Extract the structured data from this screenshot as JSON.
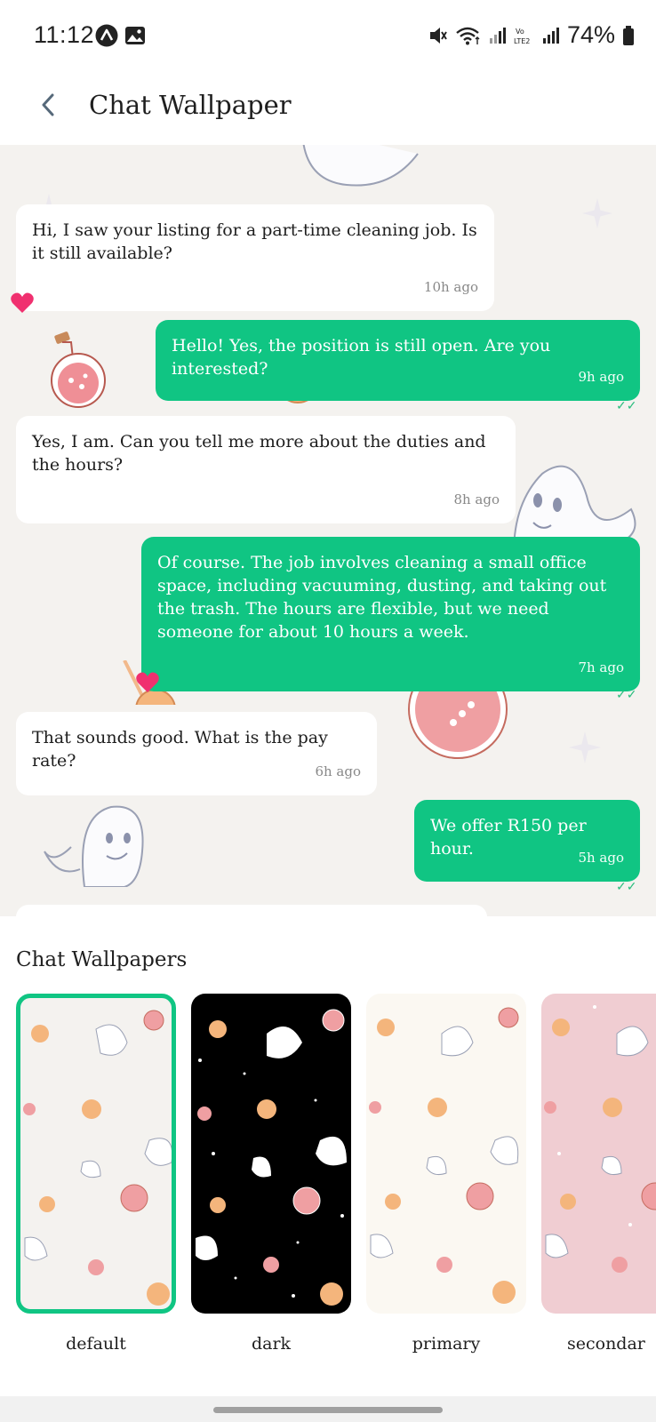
{
  "status_bar": {
    "time": "11:12",
    "battery": "74%",
    "icons": [
      "app-a-icon",
      "gallery-icon",
      "mute-icon",
      "wifi-icon",
      "signal-icon",
      "volte-icon",
      "signal2-icon",
      "battery-icon"
    ]
  },
  "header": {
    "title": "Chat Wallpaper",
    "back_icon": "chevron-left-icon"
  },
  "messages": [
    {
      "direction": "in",
      "text": "Hi, I saw your listing for a part-time cleaning job. Is it still available?",
      "time": "10h ago",
      "liked": true
    },
    {
      "direction": "out",
      "text": "Hello! Yes, the position is still open. Are you interested?",
      "time": "9h ago",
      "read": true
    },
    {
      "direction": "in",
      "text": "Yes, I am. Can you tell me more about the duties and the hours?",
      "time": "8h ago"
    },
    {
      "direction": "out",
      "text": "Of course. The job involves cleaning a small office space, including vacuuming, dusting, and taking out the trash. The hours are flexible, but we need someone for about 10 hours a week.",
      "time": "7h ago",
      "read": true,
      "liked": true
    },
    {
      "direction": "in",
      "text": "That sounds good. What is the pay rate?",
      "time": "6h ago"
    },
    {
      "direction": "out",
      "text": "We offer R150 per hour.",
      "time": "5h ago",
      "read": true
    }
  ],
  "wallpapers": {
    "title": "Chat Wallpapers",
    "items": [
      {
        "label": "default",
        "bg": "#f4f2ef",
        "selected": true
      },
      {
        "label": "dark",
        "bg": "#000000",
        "selected": false
      },
      {
        "label": "primary",
        "bg": "#fbf8f2",
        "selected": false
      },
      {
        "label": "secondar",
        "bg": "#f0cdd2",
        "selected": false
      }
    ]
  },
  "colors": {
    "accent": "#10c583",
    "chat_bg": "#f4f2ef",
    "heart": "#f0306f"
  }
}
